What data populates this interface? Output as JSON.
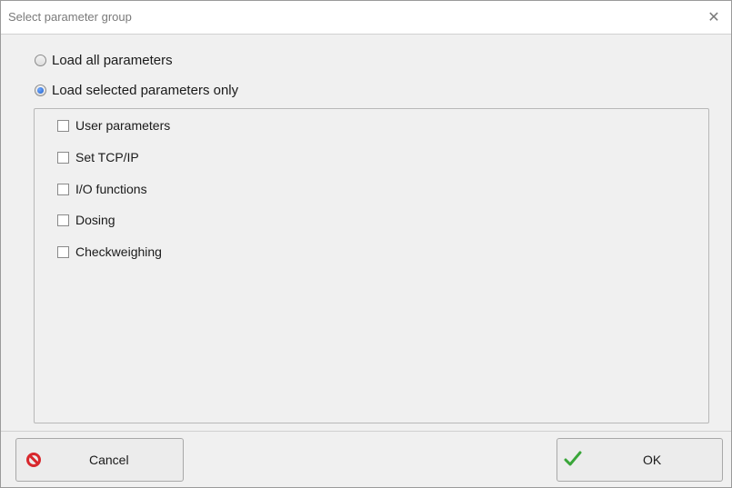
{
  "dialog": {
    "title": "Select parameter group",
    "close_icon": "close-icon"
  },
  "options": {
    "load_all": {
      "label": "Load all parameters",
      "checked": false
    },
    "load_selected": {
      "label": "Load selected parameters only",
      "checked": true
    }
  },
  "parameter_groups": [
    {
      "label": "User parameters",
      "checked": false
    },
    {
      "label": "Set TCP/IP",
      "checked": false
    },
    {
      "label": "I/O functions",
      "checked": false
    },
    {
      "label": "Dosing",
      "checked": false
    },
    {
      "label": "Checkweighing",
      "checked": false
    }
  ],
  "buttons": {
    "cancel": {
      "label": "Cancel",
      "icon": "cancel-icon",
      "icon_color": "#d8282d"
    },
    "ok": {
      "label": "OK",
      "icon": "checkmark-icon",
      "icon_color": "#3aa63a"
    }
  }
}
